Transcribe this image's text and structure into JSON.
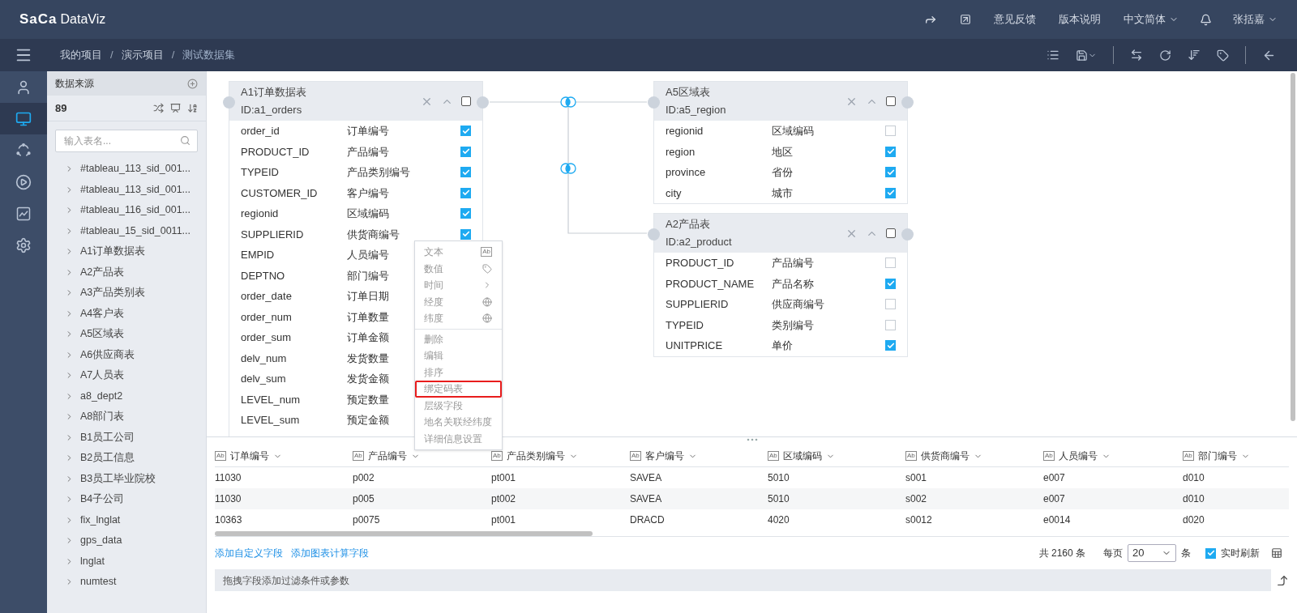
{
  "header": {
    "logo_mark": "SaCa",
    "logo_text": "DataViz",
    "links": [
      "意见反馈",
      "版本说明"
    ],
    "language": "中文简体",
    "user": "张括嘉"
  },
  "breadcrumb": {
    "separator": "/",
    "items": [
      "我的项目",
      "演示项目",
      "测试数据集"
    ]
  },
  "rail": [
    {
      "selected": false
    },
    {
      "selected": true
    },
    {
      "selected": false
    },
    {
      "selected": false
    },
    {
      "selected": false
    },
    {
      "selected": false
    }
  ],
  "sidebar": {
    "title": "数据来源",
    "count": "89",
    "search": {
      "placeholder": "输入表名..."
    },
    "items": [
      "#tableau_113_sid_001...",
      "#tableau_113_sid_001...",
      "#tableau_116_sid_001...",
      "#tableau_15_sid_0011...",
      "A1订单数据表",
      "A2产品表",
      "A3产品类别表",
      "A4客户表",
      "A5区域表",
      "A6供应商表",
      "A7人员表",
      "a8_dept2",
      "A8部门表",
      "B1员工公司",
      "B2员工信息",
      "B3员工毕业院校",
      "B4子公司",
      "fix_lnglat",
      "gps_data",
      "lnglat",
      "numtest"
    ]
  },
  "canvas": {
    "tables": [
      {
        "title": "A1订单数据表",
        "id": "ID:a1_orders",
        "checked": false,
        "fields": [
          {
            "name": "order_id",
            "label": "订单编号",
            "checked": true
          },
          {
            "name": "PRODUCT_ID",
            "label": "产品编号",
            "checked": true
          },
          {
            "name": "TYPEID",
            "label": "产品类别编号",
            "checked": true
          },
          {
            "name": "CUSTOMER_ID",
            "label": "客户编号",
            "checked": true
          },
          {
            "name": "regionid",
            "label": "区域编码",
            "checked": true
          },
          {
            "name": "SUPPLIERID",
            "label": "供货商编号",
            "checked": true
          },
          {
            "name": "EMPID",
            "label": "人员编号"
          },
          {
            "name": "DEPTNO",
            "label": "部门编号"
          },
          {
            "name": "order_date",
            "label": "订单日期"
          },
          {
            "name": "order_num",
            "label": "订单数量"
          },
          {
            "name": "order_sum",
            "label": "订单金额"
          },
          {
            "name": "delv_num",
            "label": "发货数量"
          },
          {
            "name": "delv_sum",
            "label": "发货金额"
          },
          {
            "name": "LEVEL_num",
            "label": "预定数量"
          },
          {
            "name": "LEVEL_sum",
            "label": "预定金额"
          }
        ]
      },
      {
        "title": "A5区域表",
        "id": "ID:a5_region",
        "checked": false,
        "fields": [
          {
            "name": "regionid",
            "label": "区域编码",
            "checked": false
          },
          {
            "name": "region",
            "label": "地区",
            "checked": true
          },
          {
            "name": "province",
            "label": "省份",
            "checked": true
          },
          {
            "name": "city",
            "label": "城市",
            "checked": true
          }
        ]
      },
      {
        "title": "A2产品表",
        "id": "ID:a2_product",
        "checked": false,
        "fields": [
          {
            "name": "PRODUCT_ID",
            "label": "产品编号",
            "checked": false
          },
          {
            "name": "PRODUCT_NAME",
            "label": "产品名称",
            "checked": true
          },
          {
            "name": "SUPPLIERID",
            "label": "供应商编号",
            "checked": false
          },
          {
            "name": "TYPEID",
            "label": "类别编号",
            "checked": false
          },
          {
            "name": "UNITPRICE",
            "label": "单价",
            "checked": true
          }
        ]
      }
    ],
    "context_menu": {
      "groups": [
        [
          {
            "label": "文本",
            "badge": "Ab",
            "highlighted": false
          },
          {
            "label": "数值",
            "highlighted": false
          },
          {
            "label": "时间",
            "highlighted": false
          },
          {
            "label": "经度",
            "highlighted": false
          },
          {
            "label": "纬度",
            "highlighted": false
          }
        ],
        [
          {
            "label": "删除",
            "highlighted": false
          },
          {
            "label": "编辑",
            "highlighted": false
          },
          {
            "label": "排序",
            "highlighted": false
          },
          {
            "label": "绑定码表",
            "highlighted": true
          },
          {
            "label": "层级字段",
            "highlighted": false
          },
          {
            "label": "地名关联经纬度",
            "highlighted": false
          },
          {
            "label": "详细信息设置",
            "highlighted": false
          }
        ]
      ]
    }
  },
  "grid": {
    "columns": [
      {
        "type": "Ab",
        "label": "订单编号"
      },
      {
        "type": "Ab",
        "label": "产品编号"
      },
      {
        "type": "Ab",
        "label": "产品类别编号"
      },
      {
        "type": "Ab",
        "label": "客户编号"
      },
      {
        "type": "Ab",
        "label": "区域编码"
      },
      {
        "type": "Ab",
        "label": "供货商编号"
      },
      {
        "type": "Ab",
        "label": "人员编号"
      },
      {
        "type": "Ab",
        "label": "部门编号"
      }
    ],
    "rows": [
      [
        "11030",
        "p002",
        "pt001",
        "SAVEA",
        "5010",
        "s001",
        "e007",
        "d010"
      ],
      [
        "11030",
        "p005",
        "pt002",
        "SAVEA",
        "5010",
        "s002",
        "e007",
        "d010"
      ],
      [
        "10363",
        "p0075",
        "pt001",
        "DRACD",
        "4020",
        "s0012",
        "e0014",
        "d020"
      ]
    ],
    "links": [
      "添加自定义字段",
      "添加图表计算字段"
    ],
    "total": "共 2160 条",
    "per_page": "每页",
    "page_size": "20",
    "unit": "条",
    "realtime": {
      "label": "实时刷新",
      "checked": true
    },
    "filter_placeholder": "拖拽字段添加过滤条件或参数"
  }
}
